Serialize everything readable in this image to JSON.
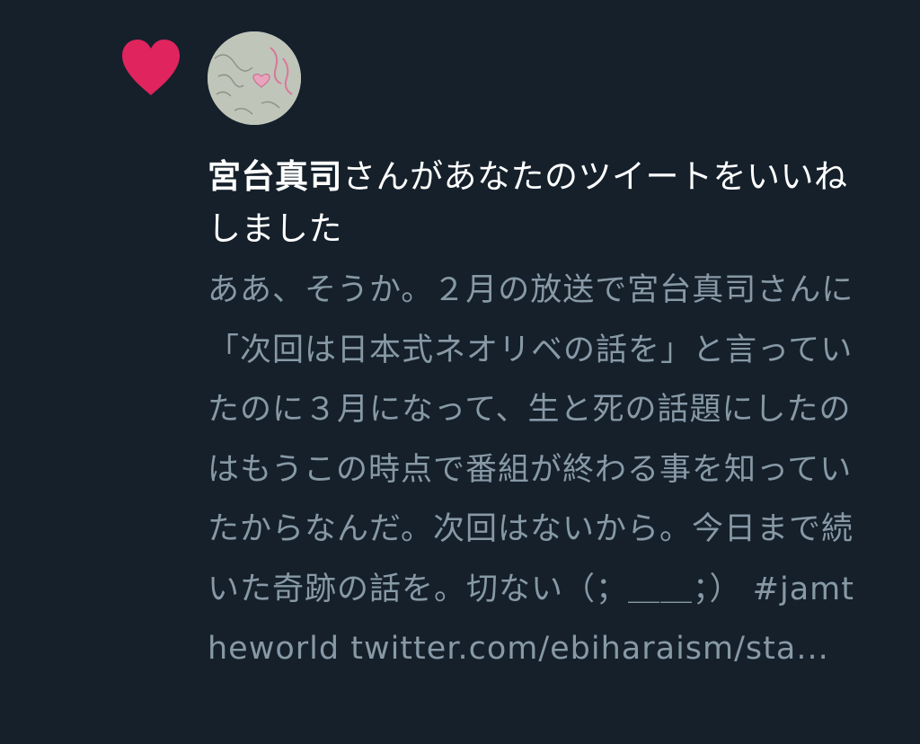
{
  "notification": {
    "type_icon": "heart-icon",
    "user_name": "宮台真司",
    "action_text": "さんがあなたのツイートをいいねしました",
    "tweet": {
      "text": "ああ、そうか。２月の放送で宮台真司さんに「次回は日本式ネオリベの話を」と言っていたのに３月になって、生と死の話題にしたのはもうこの時点で番組が終わる事を知っていたからなんだ。次回はないから。今日まで続いた奇跡の話を。切ない（；＿＿；）",
      "hashtag": "#jamtheworld",
      "link": "twitter.com/ebiharaism/sta..."
    }
  },
  "colors": {
    "background": "#15202b",
    "heart": "#e0245e",
    "primary_text": "#ffffff",
    "secondary_text": "#8899a6"
  }
}
